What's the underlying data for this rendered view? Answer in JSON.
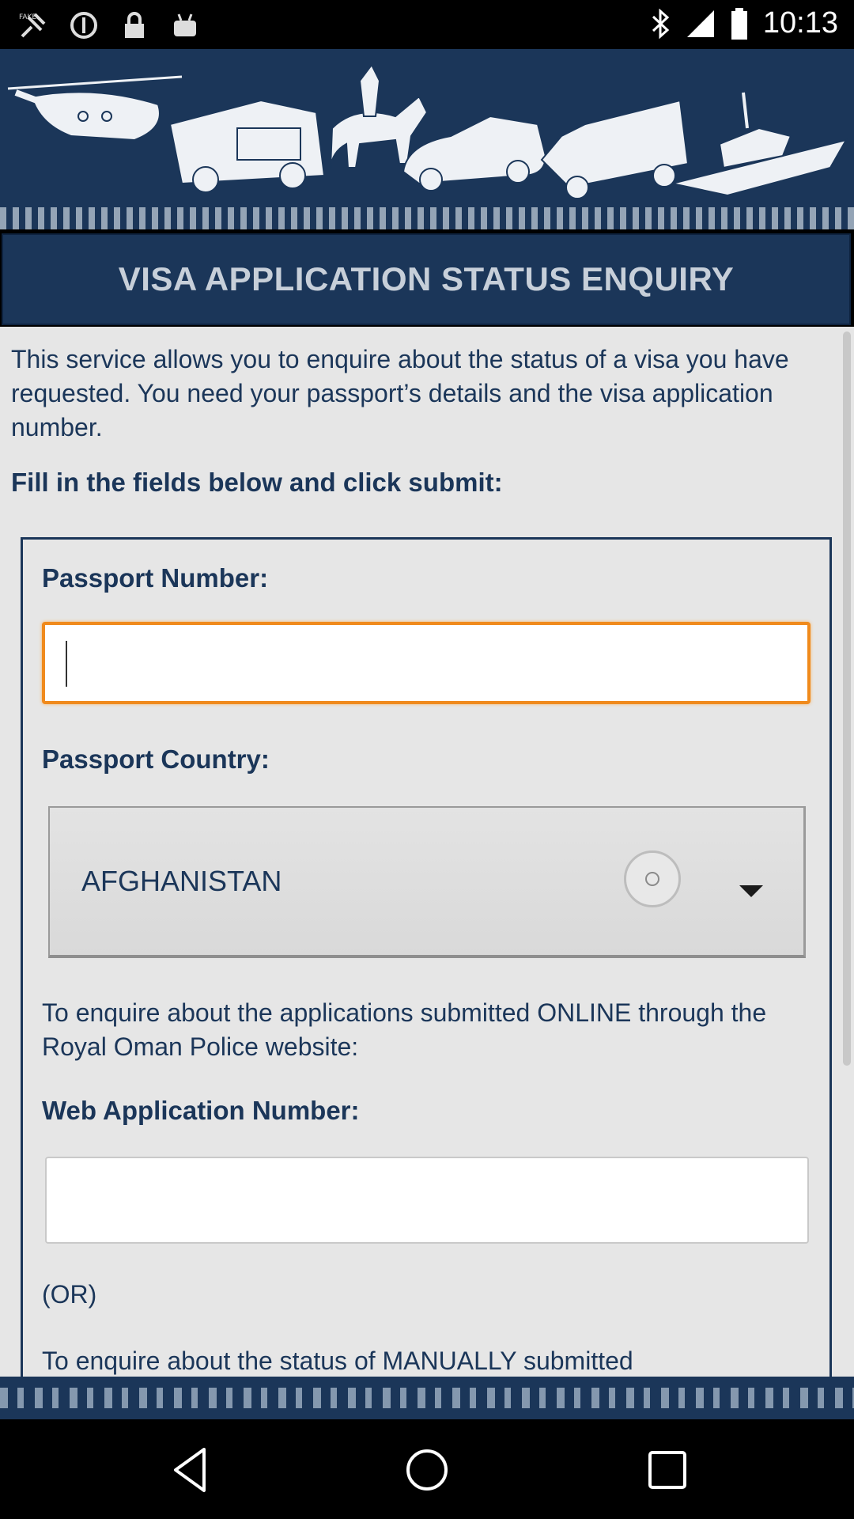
{
  "status_bar": {
    "time": "10:13",
    "icons": [
      "fake-gps-icon",
      "data-saver-icon",
      "lock-icon",
      "android-icon",
      "bluetooth-icon",
      "signal-icon",
      "battery-icon"
    ]
  },
  "banner": {
    "images": [
      "helicopter",
      "fire-truck",
      "mounted-police",
      "police-car",
      "ambulance",
      "patrol-boat"
    ]
  },
  "page": {
    "title": "VISA APPLICATION STATUS ENQUIRY",
    "intro": "This service allows you to enquire about the status of a visa you have requested. You need your passport’s details and the visa application number.",
    "instruction": "Fill in the fields below and click submit:"
  },
  "form": {
    "passport_number_label": "Passport Number:",
    "passport_number_value": "",
    "passport_country_label": "Passport Country:",
    "passport_country_value": "AFGHANISTAN",
    "online_note": "To enquire about the applications submitted ONLINE through the Royal Oman Police website:",
    "web_app_label": "Web Application Number:",
    "web_app_value": "",
    "or_text": "(OR)",
    "manual_note": "To enquire about the status of MANUALLY submitted"
  },
  "colors": {
    "navy": "#1b3659",
    "focus_orange": "#f08a1c",
    "content_bg": "#e6e6e6"
  }
}
